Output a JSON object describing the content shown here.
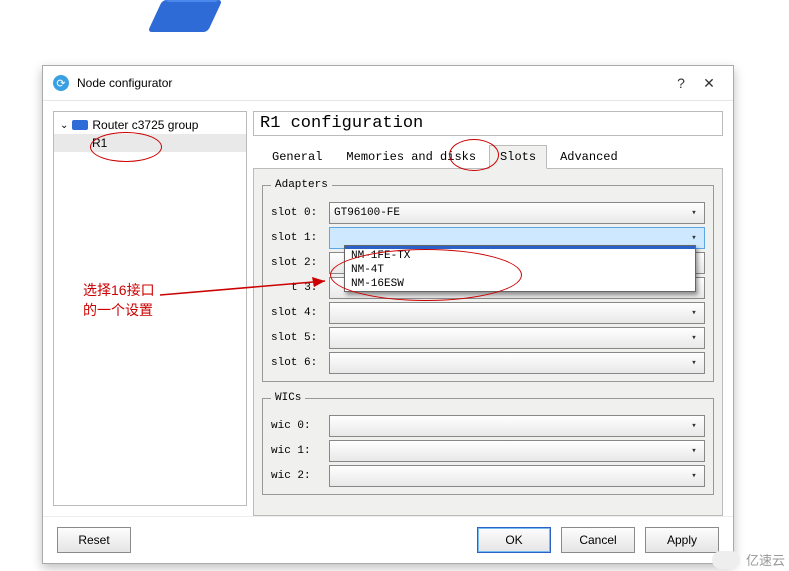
{
  "window": {
    "title": "Node configurator",
    "help": "?",
    "close": "✕"
  },
  "tree": {
    "parent": "Router c3725 group",
    "child": "R1"
  },
  "config_title": "R1 configuration",
  "tabs": {
    "general": "General",
    "mem": "Memories and disks",
    "slots": "Slots",
    "adv": "Advanced"
  },
  "adapters": {
    "legend": "Adapters",
    "rows": [
      {
        "label": "slot 0:",
        "value": "GT96100-FE"
      },
      {
        "label": "slot 1:",
        "value": ""
      },
      {
        "label": "slot 2:",
        "value": ""
      },
      {
        "label": " t 3:",
        "value": ""
      },
      {
        "label": "slot 4:",
        "value": ""
      },
      {
        "label": "slot 5:",
        "value": ""
      },
      {
        "label": "slot 6:",
        "value": ""
      }
    ],
    "options": [
      "NM-1FE-TX",
      "NM-4T",
      "NM-16ESW"
    ]
  },
  "wics": {
    "legend": "WICs",
    "rows": [
      {
        "label": "wic 0:",
        "value": ""
      },
      {
        "label": "wic 1:",
        "value": ""
      },
      {
        "label": "wic 2:",
        "value": ""
      }
    ]
  },
  "annotation": {
    "line1": "选择16接口",
    "line2": "的一个设置"
  },
  "buttons": {
    "reset": "Reset",
    "ok": "OK",
    "cancel": "Cancel",
    "apply": "Apply"
  },
  "watermark": "亿速云"
}
